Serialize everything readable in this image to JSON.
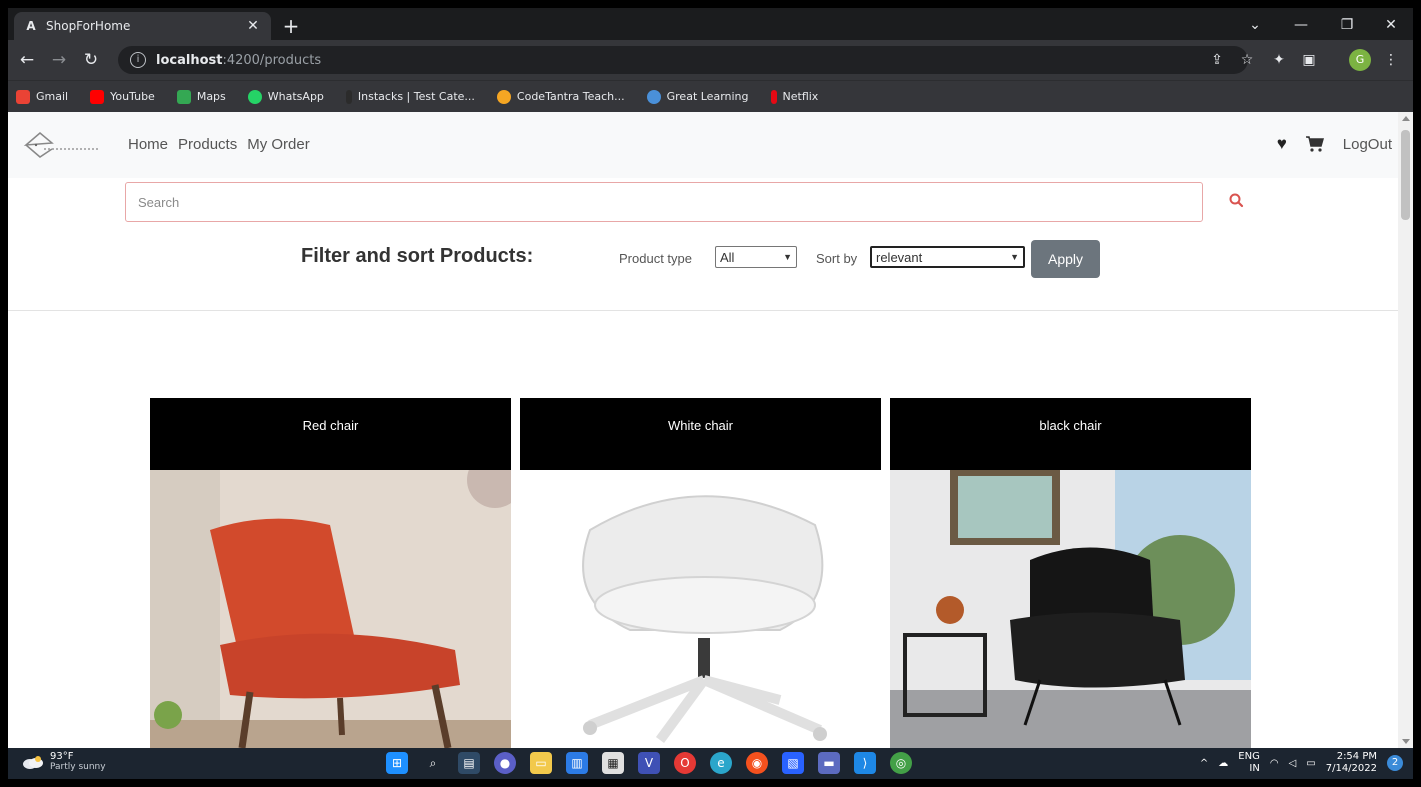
{
  "browser": {
    "tab_title": "ShopForHome",
    "tab_favicon_letter": "A",
    "url_host": "localhost",
    "url_path": ":4200/products",
    "bookmarks": [
      {
        "label": "Gmail",
        "color": "#ea4335"
      },
      {
        "label": "YouTube",
        "color": "#ff0000"
      },
      {
        "label": "Maps",
        "color": "#34a853"
      },
      {
        "label": "WhatsApp",
        "color": "#25d366"
      },
      {
        "label": "Instacks | Test Cate...",
        "color": "#2b2b2b"
      },
      {
        "label": "CodeTantra Teach...",
        "color": "#f5a623"
      },
      {
        "label": "Great Learning",
        "color": "#4a90d9"
      },
      {
        "label": "Netflix",
        "color": "#e50914"
      }
    ],
    "profile_letter": "G"
  },
  "navbar": {
    "links": [
      "Home",
      "Products",
      "My Order"
    ],
    "logout_label": "LogOut"
  },
  "search": {
    "placeholder": "Search"
  },
  "filters": {
    "title": "Filter and sort Products:",
    "product_type_label": "Product type",
    "product_type_value": "All",
    "sort_label": "Sort by",
    "sort_value": "relevant",
    "apply_label": "Apply"
  },
  "products": [
    {
      "name": "Red chair"
    },
    {
      "name": "White chair"
    },
    {
      "name": "black chair"
    }
  ],
  "taskbar": {
    "temperature": "93°F",
    "weather": "Partly sunny",
    "lang_top": "ENG",
    "lang_bottom": "IN",
    "time": "2:54 PM",
    "date": "7/14/2022"
  },
  "colors": {
    "apply_button": "#6c757d",
    "card_header": "#000000",
    "search_border": "#e8a7a7"
  }
}
